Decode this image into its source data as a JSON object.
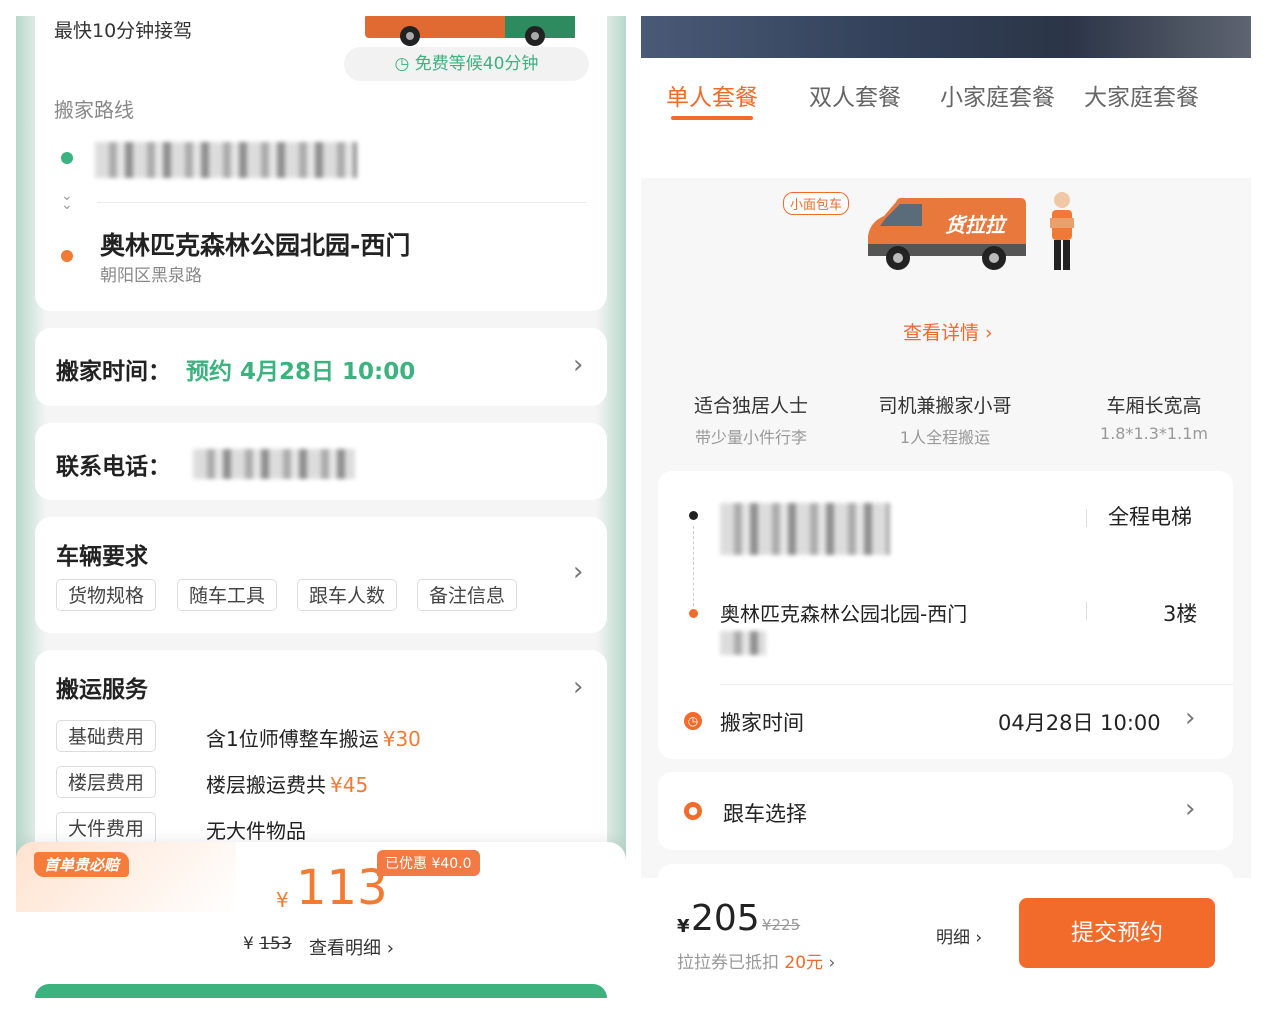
{
  "left": {
    "header": {
      "pickup_speed": "最快10分钟接驾",
      "free_wait": "免费等候40分钟"
    },
    "route": {
      "label": "搬家路线",
      "destination_name": "奥林匹克森林公园北园-西门",
      "destination_sub": "朝阳区黑泉路"
    },
    "move_time": {
      "label": "搬家时间：",
      "value": "预约 4月28日 10:00"
    },
    "contact": {
      "label": "联系电话："
    },
    "vehicle": {
      "title": "车辆要求",
      "tags": [
        "货物规格",
        "随车工具",
        "跟车人数",
        "备注信息"
      ]
    },
    "service": {
      "title": "搬运服务",
      "rows": [
        {
          "tag": "基础费用",
          "text": "含1位师傅整车搬运",
          "price": "¥30"
        },
        {
          "tag": "楼层费用",
          "text": "楼层搬运费共",
          "price": "¥45"
        },
        {
          "tag": "大件费用",
          "text": "无大件物品",
          "price": ""
        }
      ]
    },
    "footer": {
      "badge": "首单贵必赔",
      "currency": "¥",
      "price": "113",
      "discount": "已优惠 ¥40.0",
      "original_prefix": "¥",
      "original_price": "153",
      "detail_link": "查看明细"
    }
  },
  "right": {
    "tabs": [
      "单人套餐",
      "双人套餐",
      "小家庭套餐",
      "大家庭套餐"
    ],
    "vehicle_badge": "小面包车",
    "van_brand": "货拉拉",
    "details_link": "查看详情",
    "features": [
      {
        "title": "适合独居人士",
        "sub": "带少量小件行李"
      },
      {
        "title": "司机兼搬家小哥",
        "sub": "1人全程搬运"
      },
      {
        "title": "车厢长宽高",
        "sub": "1.8*1.3*1.1m"
      }
    ],
    "route": {
      "origin_floor": "全程电梯",
      "destination_name": "奥林匹克森林公园北园-西门",
      "destination_floor": "3楼"
    },
    "move_time": {
      "label": "搬家时间",
      "value": "04月28日 10:00"
    },
    "follow": {
      "label": "跟车选择"
    },
    "footer": {
      "currency": "¥",
      "price": "205",
      "original": "¥225",
      "coupon_text": "拉拉券已抵扣",
      "coupon_amount": "20元",
      "detail": "明细",
      "submit": "提交预约"
    }
  },
  "colors": {
    "green": "#3cb27f",
    "orange": "#f26b2b",
    "teal_border": "#b7d8cb"
  }
}
